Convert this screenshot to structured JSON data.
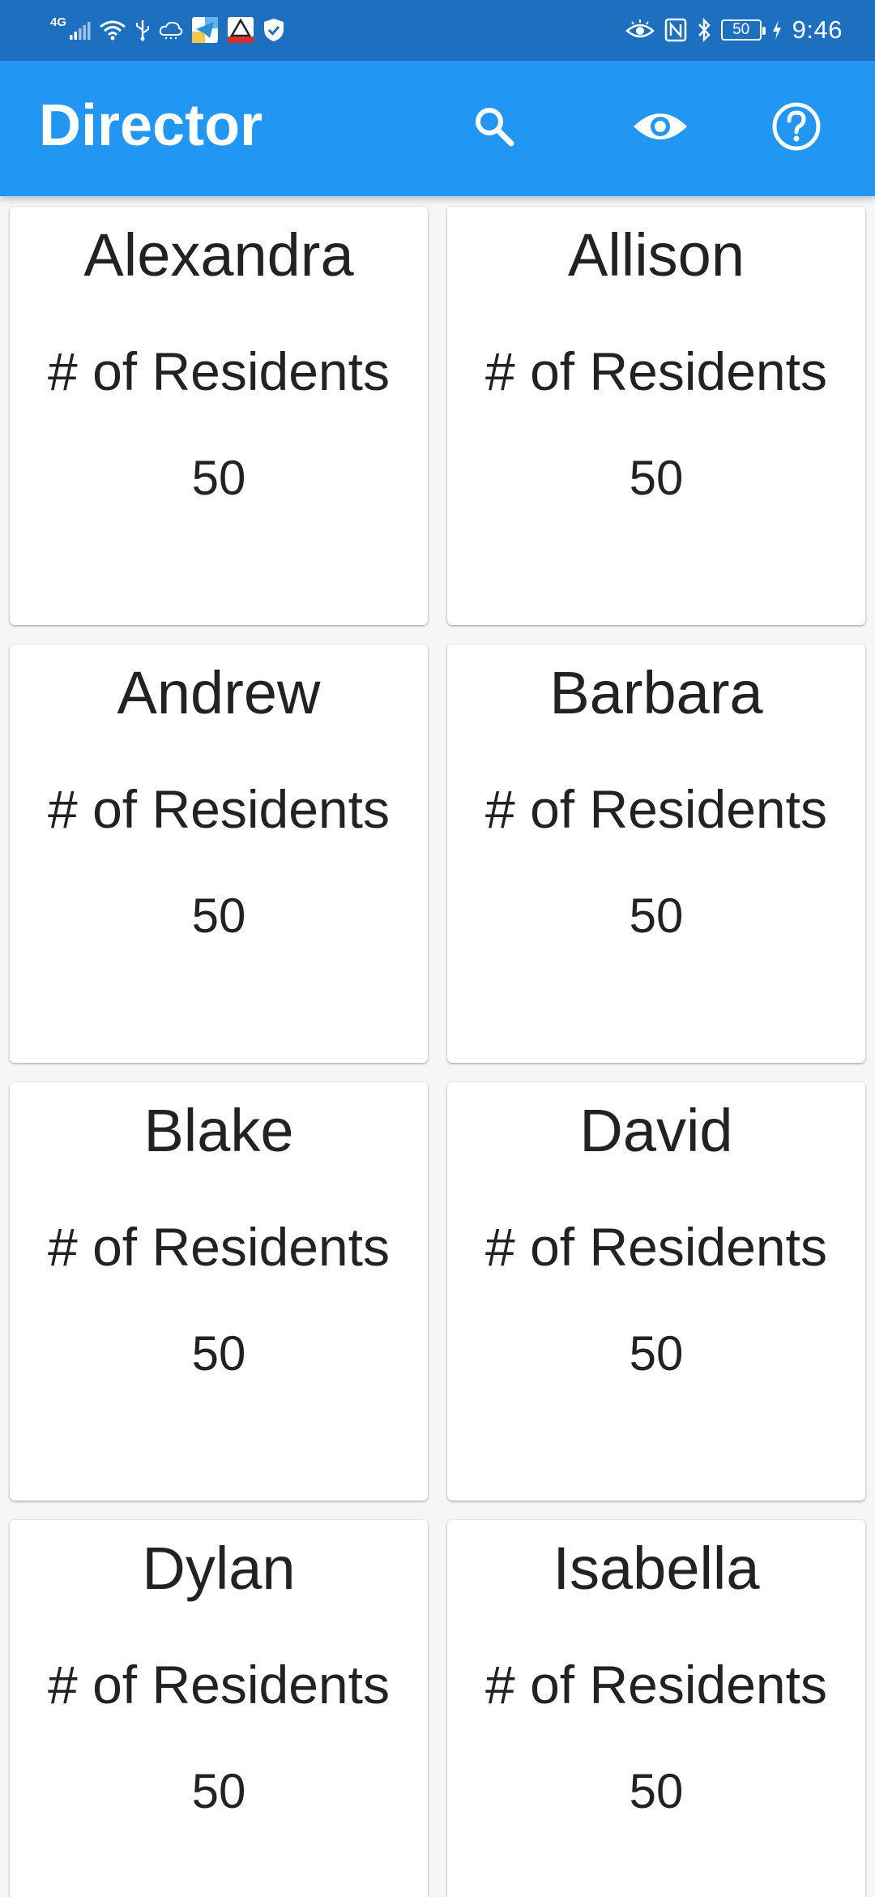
{
  "status_bar": {
    "network_label": "4G",
    "battery_level": "50",
    "time": "9:46",
    "left_icons": [
      "signal-icon",
      "wifi-icon",
      "usb-icon",
      "cloud-icon",
      "telegram-icon",
      "app-badge-icon",
      "shield-icon"
    ],
    "right_icons": [
      "eye-comfort-icon",
      "nfc-icon",
      "bluetooth-icon",
      "battery-icon",
      "charging-icon"
    ]
  },
  "app_bar": {
    "title": "Director",
    "actions": [
      "search-icon",
      "eye-icon",
      "help-icon"
    ],
    "color": "#2196f3"
  },
  "cards": [
    {
      "name": "Alexandra",
      "label": "# of Residents",
      "count": "50"
    },
    {
      "name": "Allison",
      "label": "# of Residents",
      "count": "50"
    },
    {
      "name": "Andrew",
      "label": "# of Residents",
      "count": "50"
    },
    {
      "name": "Barbara",
      "label": "# of Residents",
      "count": "50"
    },
    {
      "name": "Blake",
      "label": "# of Residents",
      "count": "50"
    },
    {
      "name": "David",
      "label": "# of Residents",
      "count": "50"
    },
    {
      "name": "Dylan",
      "label": "# of Residents",
      "count": "50"
    },
    {
      "name": "Isabella",
      "label": "# of Residents",
      "count": "50"
    }
  ]
}
